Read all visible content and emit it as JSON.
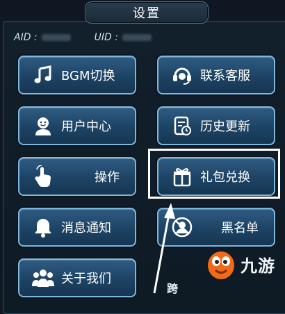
{
  "header": {
    "title": "设置"
  },
  "ids": {
    "aid_label": "AID :",
    "uid_label": "UID :"
  },
  "buttons": [
    {
      "label": "BGM切换",
      "icon": "music-note-icon"
    },
    {
      "label": "联系客服",
      "icon": "headset-icon"
    },
    {
      "label": "用户中心",
      "icon": "user-icon"
    },
    {
      "label": "历史更新",
      "icon": "update-history-icon"
    },
    {
      "label": "操作",
      "icon": "tap-hand-icon"
    },
    {
      "label": "礼包兑换",
      "icon": "gift-icon"
    },
    {
      "label": "消息通知",
      "icon": "bell-icon"
    },
    {
      "label": "黑名单",
      "icon": "blacklist-user-icon"
    },
    {
      "label": "关于我们",
      "icon": "group-icon"
    }
  ],
  "watermark": {
    "text": "九游"
  },
  "partial_text": "跨",
  "colors": {
    "button_fill": "#1d4364",
    "button_border": "#7fb7dc",
    "highlight": "#ffffff"
  }
}
